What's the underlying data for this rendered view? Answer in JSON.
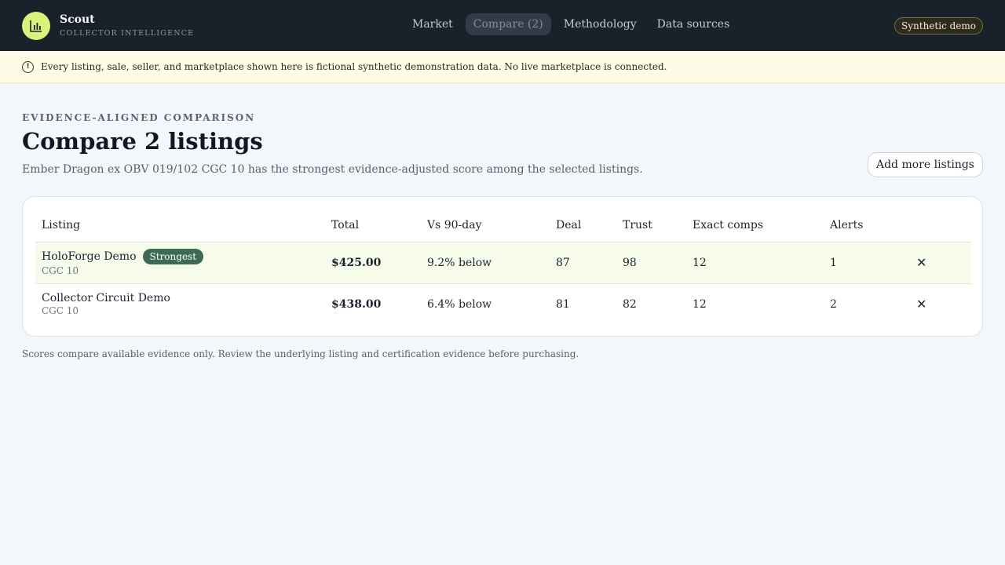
{
  "header": {
    "brand_name": "Scout",
    "brand_tagline": "COLLECTOR INTELLIGENCE",
    "logo_icon": "bar-chart-icon",
    "nav": [
      {
        "label": "Market",
        "active": false
      },
      {
        "label": "Compare (2)",
        "active": true
      },
      {
        "label": "Methodology",
        "active": false
      },
      {
        "label": "Data sources",
        "active": false
      }
    ],
    "badge": "Synthetic demo"
  },
  "banner": {
    "icon": "alert-circle-icon",
    "text": "Every listing, sale, seller, and marketplace shown here is fictional synthetic demonstration data. No live marketplace is connected."
  },
  "page": {
    "eyebrow": "EVIDENCE-ALIGNED COMPARISON",
    "title": "Compare 2 listings",
    "subtitle": "Ember Dragon ex OBV 019/102 CGC 10 has the strongest evidence-adjusted score among the selected listings.",
    "add_button": "Add more listings",
    "footnote": "Scores compare available evidence only. Review the underlying listing and certification evidence before purchasing."
  },
  "table": {
    "columns": [
      "Listing",
      "Total",
      "Vs 90-day",
      "Deal",
      "Trust",
      "Exact comps",
      "Alerts"
    ],
    "rows": [
      {
        "seller": "HoloForge Demo",
        "grade": "CGC 10",
        "badge": "Strongest",
        "total": "$425.00",
        "vs90": "9.2% below",
        "deal": "87",
        "trust": "98",
        "comps": "12",
        "alerts": "1"
      },
      {
        "seller": "Collector Circuit Demo",
        "grade": "CGC 10",
        "badge": "",
        "total": "$438.00",
        "vs90": "6.4% below",
        "deal": "81",
        "trust": "82",
        "comps": "12",
        "alerts": "2"
      }
    ]
  },
  "colors": {
    "header_bg": "#19212b",
    "logo_accent": "#d9f27a",
    "banner_bg": "#fefbe6",
    "strongest_badge": "#3c6a55",
    "highlight_row": "#f7fbea"
  }
}
